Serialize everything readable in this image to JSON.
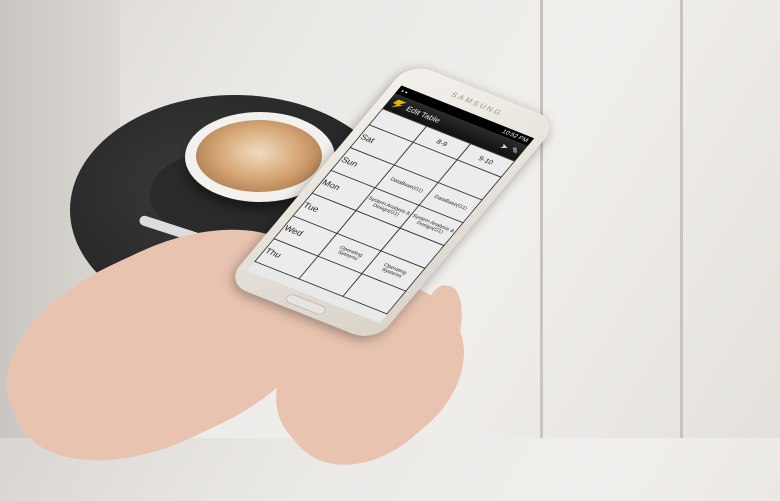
{
  "status_bar": {
    "time": "10:52 PM"
  },
  "phone_brand": "SAMSUNG",
  "action_bar": {
    "title": "Edit Table",
    "send_icon": "send-icon",
    "edit_icon": "pencil-icon"
  },
  "timetable": {
    "headers": [
      "",
      "8-9",
      "9-10"
    ],
    "rows": [
      {
        "day": "Sat",
        "cells": [
          "",
          ""
        ]
      },
      {
        "day": "Sun",
        "cells": [
          "DataBase(G1)",
          "DataBase(G1)"
        ]
      },
      {
        "day": "Mon",
        "cells": [
          "System Analysis & Design(G1)",
          "System Analysis & Design(G1)"
        ]
      },
      {
        "day": "Tue",
        "cells": [
          "",
          ""
        ]
      },
      {
        "day": "Wed",
        "cells": [
          "Operating Systems",
          "Operating Systems"
        ]
      },
      {
        "day": "Thu",
        "cells": [
          "",
          ""
        ]
      }
    ]
  }
}
